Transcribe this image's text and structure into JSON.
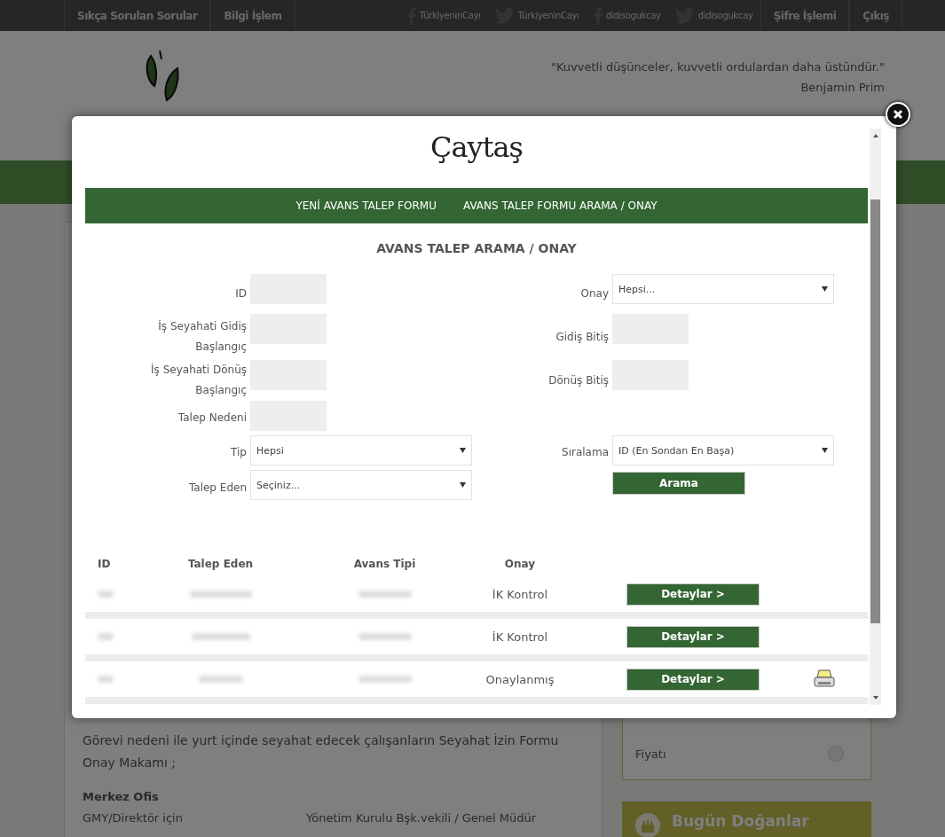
{
  "top_nav": {
    "left_links": [
      "Sıkça Sorulan Sorular",
      "Bilgi İşlem"
    ],
    "social": [
      {
        "kind": "facebook",
        "label": "TürkiyeninCayı"
      },
      {
        "kind": "twitter",
        "label": "TürkiyeninCayı"
      },
      {
        "kind": "facebook",
        "label": "didisogukcay"
      },
      {
        "kind": "twitter",
        "label": "didisogukcay"
      }
    ],
    "right_links": [
      "Şifre İşlemi",
      "Çıkış"
    ]
  },
  "header": {
    "quote": "\"Kuvvetli düşünceler, kuvvetli ordulardan daha üstündür.\"",
    "author": "Benjamin Prim"
  },
  "background": {
    "paragraph": "Görevi nedeni ile yurt içinde seyahat edecek çalışanların Seyahat İzin Formu Onay Makamı ;",
    "section": "Merkez Ofis",
    "rows": [
      [
        "GMY/Direktör için",
        "Yönetim Kurulu Bşk.vekili / Genel Müdür"
      ]
    ],
    "options": [
      {
        "label": "Fiyatı",
        "checked": false
      }
    ],
    "birthdays": "Bugün Doğanlar"
  },
  "modal": {
    "logo": "Çaytaş",
    "nav": [
      "YENİ AVANS TALEP FORMU",
      "AVANS TALEP FORMU ARAMA / ONAY"
    ],
    "title": "AVANS TALEP ARAMA / ONAY",
    "form_rows": [
      {
        "left": {
          "label": "ID",
          "kind": "text"
        },
        "right": {
          "label": "Onay",
          "kind": "select",
          "value": "Hepsi..."
        }
      },
      {
        "left": {
          "label": "İş Seyahati Gidiş Başlangıç",
          "kind": "text"
        },
        "right": {
          "label": "Gidiş Bitiş",
          "kind": "text"
        }
      },
      {
        "left": {
          "label": "İş Seyahati Dönüş Başlangıç",
          "kind": "text"
        },
        "right": {
          "label": "Dönüş Bitiş",
          "kind": "text"
        }
      },
      {
        "left": {
          "label": "Talep Nedeni",
          "kind": "text"
        }
      },
      {
        "left": {
          "label": "Tip",
          "kind": "select",
          "value": "Hepsi"
        },
        "right": {
          "label": "Sıralama",
          "kind": "select",
          "value": "ID (En Sondan En Başa)"
        }
      },
      {
        "left": {
          "label": "Talep Eden",
          "kind": "select",
          "value": "Seçiniz..."
        },
        "right": {
          "kind": "button",
          "value": "Arama"
        }
      }
    ],
    "table": {
      "columns": [
        "ID",
        "Talep Eden",
        "Avans Tipi",
        "Onay"
      ],
      "rows": [
        {
          "onay": "İK Kontrol",
          "button": "Detaylar >",
          "printable": false
        },
        {
          "onay": "İK Kontrol",
          "button": "Detaylar >",
          "printable": false
        },
        {
          "onay": "Onaylanmış",
          "button": "Detaylar >",
          "printable": true
        }
      ]
    }
  }
}
